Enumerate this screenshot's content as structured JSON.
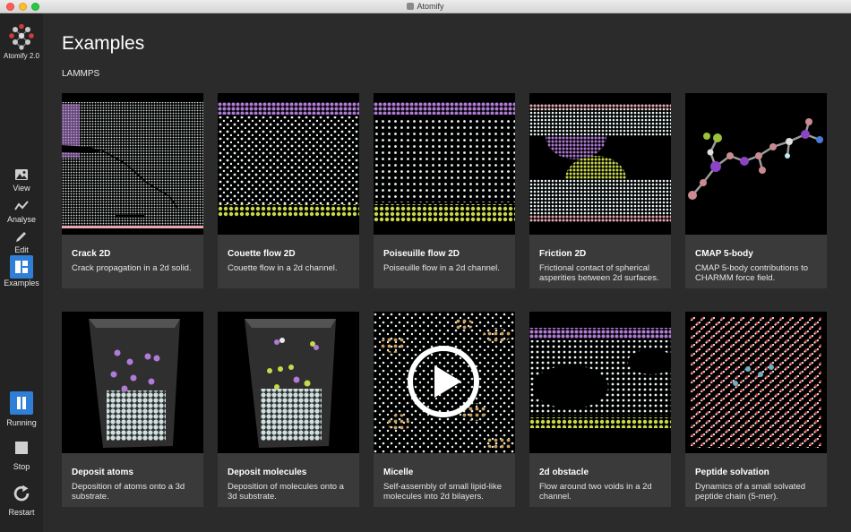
{
  "window": {
    "title": "Atomify"
  },
  "app": {
    "logo_label": "Atomify 2.0"
  },
  "sidebar": {
    "nav": [
      {
        "label": "View",
        "icon": "image-icon"
      },
      {
        "label": "Analyse",
        "icon": "chart-icon"
      },
      {
        "label": "Edit",
        "icon": "pencil-icon"
      },
      {
        "label": "Examples",
        "icon": "grid-icon"
      }
    ],
    "controls": [
      {
        "label": "Running",
        "icon": "pause-icon"
      },
      {
        "label": "Stop",
        "icon": "stop-icon"
      },
      {
        "label": "Restart",
        "icon": "restart-icon"
      }
    ]
  },
  "main": {
    "title": "Examples",
    "section": "LAMMPS",
    "cards": [
      {
        "title": "Crack 2D",
        "desc": "Crack propagation in a 2d solid."
      },
      {
        "title": "Couette flow 2D",
        "desc": "Couette flow in a 2d channel."
      },
      {
        "title": "Poiseuille flow 2D",
        "desc": "Poiseuille flow in a 2d channel."
      },
      {
        "title": "Friction 2D",
        "desc": "Frictional contact of spherical asperities between 2d surfaces."
      },
      {
        "title": "CMAP 5-body",
        "desc": "CMAP 5-body contributions to CHARMM force field."
      },
      {
        "title": "Deposit atoms",
        "desc": "Deposition of atoms onto a 3d substrate."
      },
      {
        "title": "Deposit molecules",
        "desc": "Deposition of molecules onto a 3d substrate."
      },
      {
        "title": "Micelle",
        "desc": "Self-assembly of small lipid-like molecules into 2d bilayers."
      },
      {
        "title": "2d obstacle",
        "desc": "Flow around two voids in a 2d channel."
      },
      {
        "title": "Peptide solvation",
        "desc": "Dynamics of a small solvated peptide chain (5-mer)."
      }
    ]
  },
  "colors": {
    "accent": "#2f7fd6",
    "atom_white": "#e8f4f4",
    "atom_purple": "#b07ad6",
    "atom_yellow": "#c8d84a",
    "atom_pink": "#e8a8b0"
  }
}
